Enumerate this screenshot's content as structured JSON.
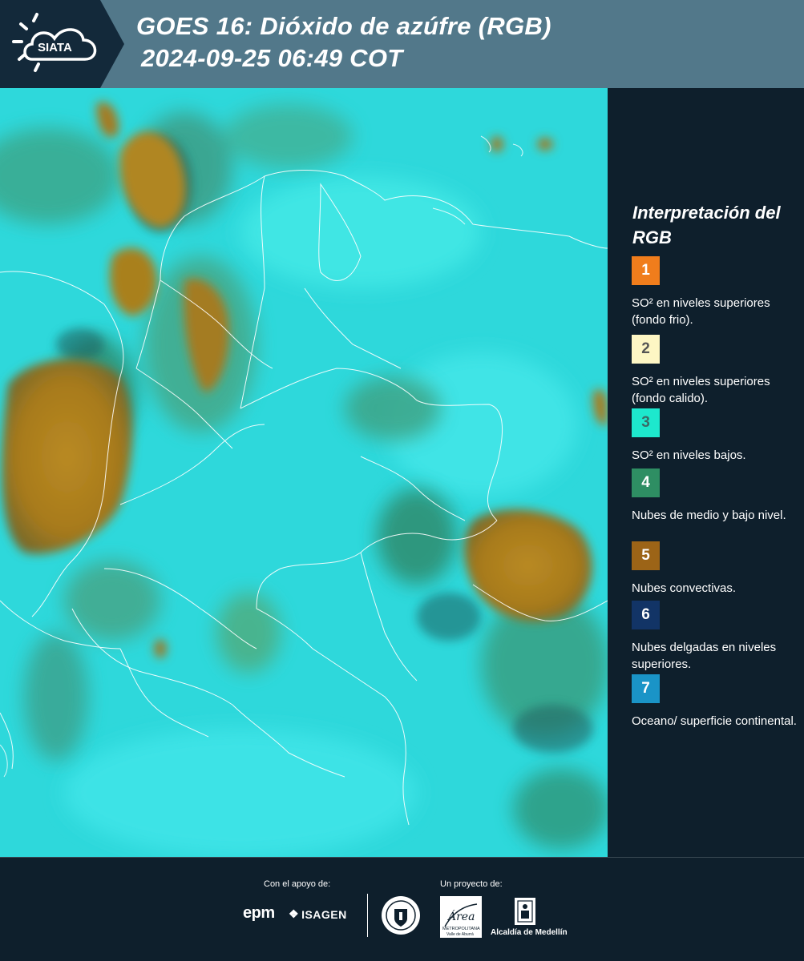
{
  "header": {
    "logo_text": "SIATA",
    "title": "GOES 16: Dióxido de azúfre (RGB)",
    "datetime": "2024-09-25 06:49 COT"
  },
  "legend": {
    "title": "Interpretación del RGB",
    "items": [
      {
        "number": "1",
        "color": "#f07d1c",
        "number_color": "#ffffff",
        "text": "SO² en niveles superiores (fondo frio)."
      },
      {
        "number": "2",
        "color": "#fdf6c4",
        "number_color": "#555555",
        "text": "SO² en niveles superiores (fondo calido)."
      },
      {
        "number": "3",
        "color": "#1de8cd",
        "number_color": "#3a6a66",
        "text": "SO² en niveles bajos."
      },
      {
        "number": "4",
        "color": "#2e8e63",
        "number_color": "#ffffff",
        "text": "Nubes de medio y bajo nivel."
      },
      {
        "number": "5",
        "color": "#9c6417",
        "number_color": "#ffffff",
        "text": "Nubes convectivas."
      },
      {
        "number": "6",
        "color": "#123466",
        "number_color": "#ffffff",
        "text": "Nubes delgadas en niveles superiores."
      },
      {
        "number": "7",
        "color": "#1a94c7",
        "number_color": "#ffffff",
        "text": "Oceano/ superficie continental."
      }
    ]
  },
  "footer": {
    "support_label": "Con el apoyo de:",
    "project_label": "Un proyecto de:",
    "epm": "epm",
    "isagen": "ISAGEN",
    "area_top": "Área",
    "area_sub": "METROPOLITANA",
    "area_sub2": "Valle de Aburrá",
    "alcaldia": "Alcaldía de Medellín"
  }
}
